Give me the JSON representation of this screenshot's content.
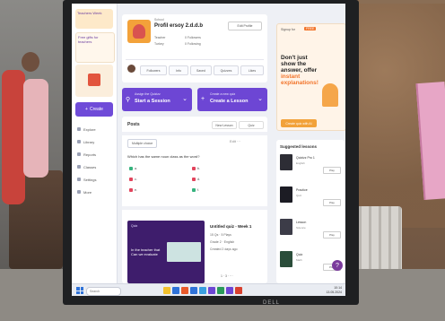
{
  "sidebar": {
    "promo_title": "Teachers Week",
    "promo2_title": "Free gifts for teachers",
    "create_label": "Create",
    "items": [
      {
        "label": "Explore",
        "icon": "compass-icon"
      },
      {
        "label": "Library",
        "icon": "library-icon"
      },
      {
        "label": "Reports",
        "icon": "reports-icon"
      },
      {
        "label": "Classes",
        "icon": "classes-icon"
      },
      {
        "label": "Settings",
        "icon": "settings-icon"
      },
      {
        "label": "More",
        "icon": "more-icon"
      }
    ]
  },
  "profile": {
    "school_label": "School",
    "name": "Profil ersoy 2.d.d.b",
    "edit_label": "Edit Profile",
    "meta": [
      "Teacher",
      "0 Followers",
      "Turkey",
      "0 Following"
    ],
    "tags": [
      "Followers",
      "Info",
      "Saved",
      "Quizzes",
      "Likes"
    ]
  },
  "actions": [
    {
      "label": "Assign the Quizizz",
      "main": "Start a Session",
      "icon": "search-icon"
    },
    {
      "label": "Create a new quiz",
      "main": "Create a Lesson",
      "icon": "plus-icon"
    }
  ],
  "feed": {
    "heading": "Posts",
    "buttons": [
      "New Lesson",
      "Quiz"
    ],
    "chip_label": "Multiple choice",
    "post_icons": "Edit  ···",
    "question": "Which has the same noun class as the word?",
    "options": [
      {
        "label": "a.",
        "color": "#36b37e"
      },
      {
        "label": "b.",
        "color": "#e2445c"
      },
      {
        "label": "c.",
        "color": "#e2445c"
      },
      {
        "label": "d.",
        "color": "#e2445c"
      },
      {
        "label": "e.",
        "color": "#e2445c"
      },
      {
        "label": "f.",
        "color": "#36b37e"
      }
    ],
    "quiz_card": {
      "tag": "Quiz",
      "title": "In the teacher that Can we evaluate",
      "info_title": "Untitled quiz - Week 1",
      "info_lines": [
        "15 Qs  ·  5 Plays",
        "Grade 2 · English",
        "Created 2 days ago"
      ],
      "footer": "1  ·  3  ·  ···"
    }
  },
  "promo": {
    "top": "Signup for",
    "badge": "FREE",
    "headline_1": "Don't just show the answer, offer",
    "headline_hi": "instant explanations!",
    "button": "Create quiz with AI"
  },
  "suggest": {
    "heading": "Suggested lessons",
    "items": [
      {
        "title": "Quizizz Pro 1",
        "sub": "English",
        "btn": "Play"
      },
      {
        "title": "Practice",
        "sub": "Quiz",
        "btn": "Play"
      },
      {
        "title": "Lesson",
        "sub": "Science",
        "btn": "Play"
      },
      {
        "title": "Quiz",
        "sub": "Math",
        "btn": "Play"
      }
    ]
  },
  "taskbar": {
    "search_placeholder": "Search",
    "time": "10:14",
    "date": "13.05.2024",
    "apps": [
      "#f2c12e",
      "#2f72d8",
      "#e85a2b",
      "#2f72d8",
      "#3aa0e0",
      "#6d46d4",
      "#2a9a5a",
      "#6d46d4",
      "#d8412f"
    ]
  },
  "monitor": {
    "brand": "DELL"
  }
}
